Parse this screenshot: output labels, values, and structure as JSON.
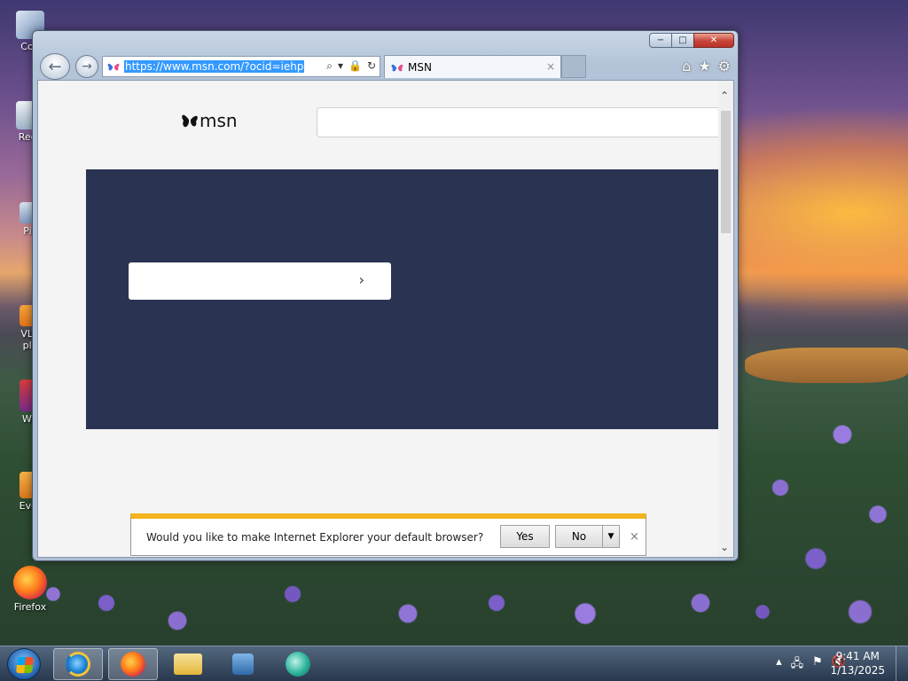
{
  "desktop": {
    "icons": [
      {
        "label": "Con"
      },
      {
        "label": "Recy"
      },
      {
        "label": "Pic"
      },
      {
        "label": "VLC\npla"
      },
      {
        "label": "Wir"
      },
      {
        "label": "Ever"
      },
      {
        "label": "Firefox"
      }
    ]
  },
  "browser": {
    "address": {
      "url": "https://www.msn.com/?ocid=iehp"
    },
    "tab": {
      "title": "MSN",
      "close": "×"
    },
    "caption": {
      "minimize": "−",
      "maximize": "□",
      "close": "✕"
    },
    "nav": {
      "back": "←",
      "forward": "→"
    },
    "tools": {
      "home": "⌂",
      "favorites": "★",
      "settings": "⚙"
    },
    "page": {
      "logo_text": "msn"
    }
  },
  "notification": {
    "text": "Would you like to make Internet Explorer your default browser?",
    "yes": "Yes",
    "no": "No",
    "close": "×"
  },
  "taskbar": {
    "time": "9:41 AM",
    "date": "1/13/2025"
  },
  "colors": {
    "accent": "#3399ff",
    "hero": "#2a3452",
    "notify_bar": "#f2b31e"
  }
}
